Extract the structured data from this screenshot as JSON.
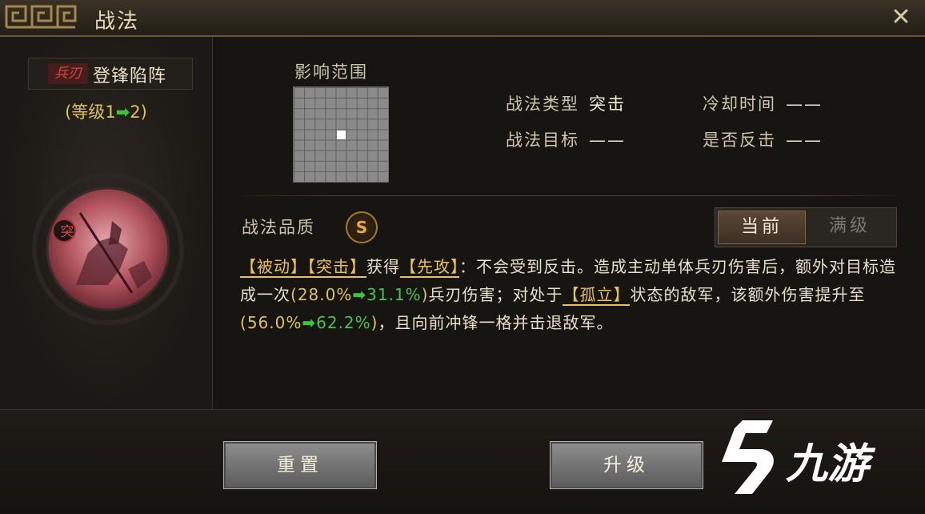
{
  "window": {
    "title": "战法"
  },
  "skill": {
    "weapon_tag": "兵刃",
    "name": "登锋陷阵",
    "level_prefix": "(等级",
    "level_from": "1",
    "level_to": "2",
    "level_suffix": ")",
    "emblem_badge": "突"
  },
  "range": {
    "label": "影响范围",
    "grid_size": 9
  },
  "info": {
    "type_label": "战法类型",
    "type_value": "突击",
    "cooldown_label": "冷却时间",
    "cooldown_value": "——",
    "target_label": "战法目标",
    "target_value": "——",
    "counter_label": "是否反击",
    "counter_value": "——"
  },
  "quality": {
    "label": "战法品质",
    "grade": "S"
  },
  "toggle": {
    "current": "当前",
    "max": "满级"
  },
  "description": {
    "k1": "【被动】",
    "k2": "【突击】",
    "t1": "获得",
    "k3": "【先攻】",
    "t2": "：不会受到反击。造成主动单体兵刃伤害后，额外对目标造成一次",
    "v1_open": "(",
    "v1a": "28.0%",
    "v1b": "31.1%",
    "v1_close": ")",
    "t3": "兵刃伤害；对处于",
    "k4": "【孤立】",
    "t4": "状态的敌军，该额外伤害提升至",
    "v2_open": "(",
    "v2a": "56.0%",
    "v2b": "62.2%",
    "v2_close": ")",
    "t5": "，且向前冲锋一格并击退敌军。"
  },
  "buttons": {
    "reset": "重置",
    "upgrade": "升级"
  },
  "watermark": {
    "text": "九游"
  },
  "colors": {
    "accent_gold": "#ebc150",
    "accent_green": "#41c23c",
    "weapon_red": "#d24a43"
  }
}
